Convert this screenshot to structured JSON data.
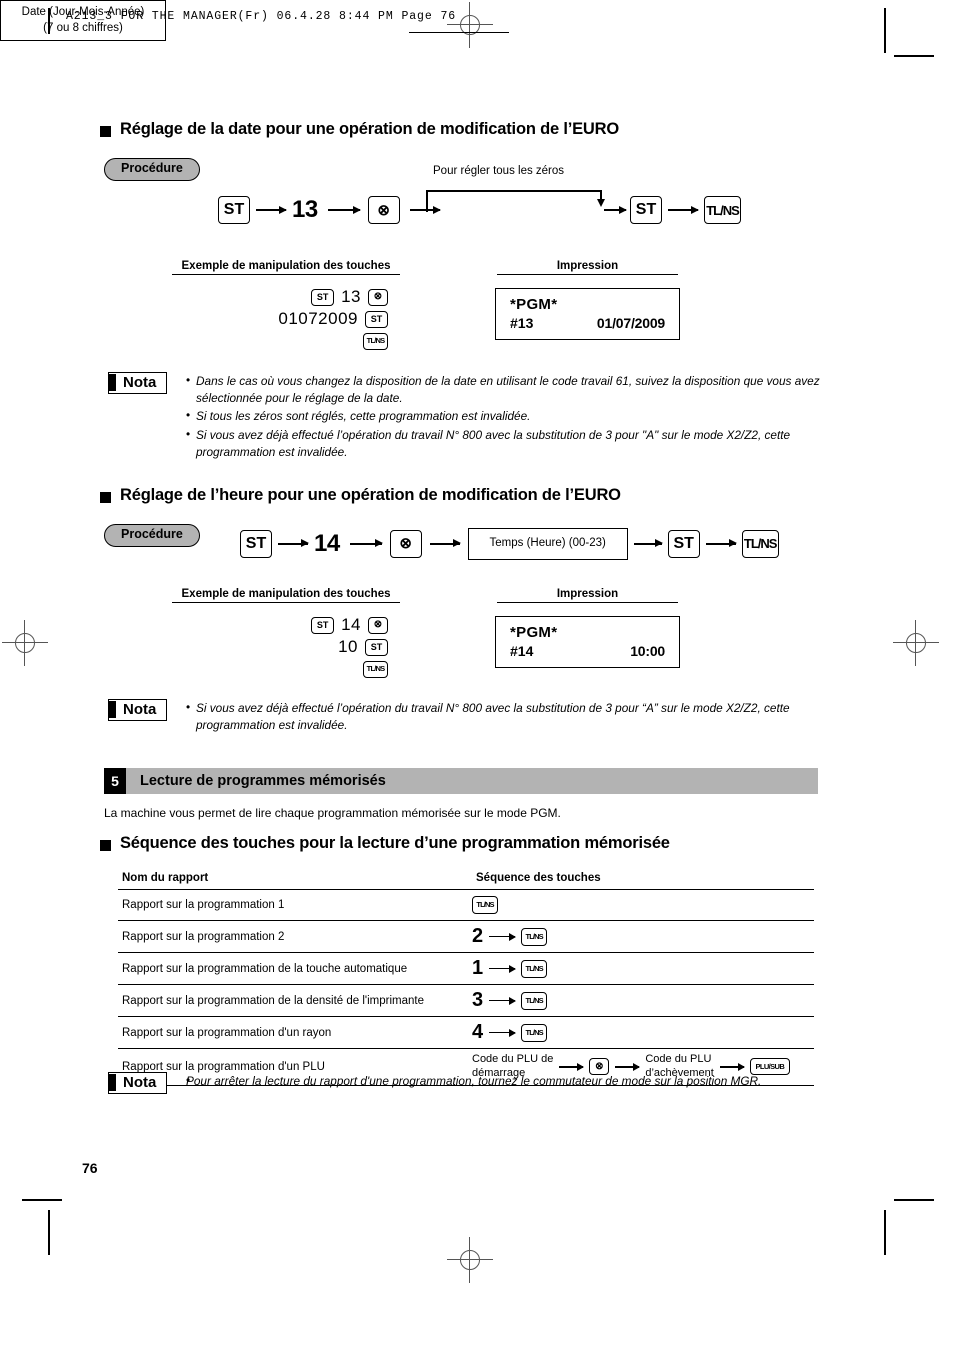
{
  "running_head": "A213_3 FOR THE MANAGER(Fr)   06.4.28 8:44 PM   Page 76",
  "page_number": "76",
  "labels": {
    "procedure": "Procédure",
    "nota": "Nota",
    "example_header": "Exemple de manipulation des touches",
    "impression_header": "Impression"
  },
  "keys": {
    "st": "ST",
    "multiply": "⊗",
    "tlns": "TL/NS",
    "plusub": "PLU/SUB"
  },
  "section_date": {
    "heading": "Réglage de la date pour une opération de modification de l’EURO",
    "flow": {
      "code": "13",
      "loop_label": "Pour régler tous les zéros",
      "databox_line1": "Date (Jour-Mois-Année)",
      "databox_line2": "(7 ou 8 chiffres)"
    },
    "example": {
      "line1_value": "13",
      "line2_value": "01072009"
    },
    "receipt": {
      "title": "*PGM*",
      "code": "#13",
      "value": "01/07/2009"
    },
    "nota": [
      "Dans le cas où vous changez la disposition de la date en utilisant le code travail 61, suivez la disposition que vous avez sélectionnée pour le réglage de la date.",
      "Si tous les zéros sont réglés, cette programmation est invalidée.",
      "Si vous avez déjà effectué l’opération du travail N° 800 avec la substitution de 3 pour \"A\" sur le mode X2/Z2, cette programmation est invalidée."
    ]
  },
  "section_time": {
    "heading": "Réglage de l’heure pour une opération de modification de l’EURO",
    "flow": {
      "code": "14",
      "databox_line1": "Temps (Heure) (00-23)"
    },
    "example": {
      "line1_value": "14",
      "line2_value": "10"
    },
    "receipt": {
      "title": "*PGM*",
      "code": "#14",
      "value": "10:00"
    },
    "nota": [
      "Si vous avez déjà effectué l’opération du travail N° 800 avec la substitution de 3 pour  “A” sur le mode X2/Z2, cette programmation est invalidée."
    ]
  },
  "section_read": {
    "number": "5",
    "banner_title": "Lecture de programmes mémorisés",
    "intro": "La machine vous permet de lire chaque programmation mémorisée sur le mode PGM.",
    "subheading": "Séquence des touches pour la lecture d’une programmation mémorisée",
    "table": {
      "headers": [
        "Nom du rapport",
        "Séquence des touches"
      ],
      "rows": [
        {
          "name": "Rapport sur la programmation 1",
          "digit": "",
          "key": "TL/NS"
        },
        {
          "name": "Rapport sur la programmation 2",
          "digit": "2",
          "key": "TL/NS"
        },
        {
          "name": "Rapport sur la programmation de la touche automatique",
          "digit": "1",
          "key": "TL/NS"
        },
        {
          "name": "Rapport sur la programmation de la densité de l'imprimante",
          "digit": "3",
          "key": "TL/NS"
        },
        {
          "name": "Rapport sur la programmation d'un rayon",
          "digit": "4",
          "key": "TL/NS"
        }
      ],
      "plu_row": {
        "name": "Rapport sur la programmation d'un PLU",
        "label1_line1": "Code du PLU de",
        "label1_line2": "démarrage",
        "label2_line1": "Code du PLU",
        "label2_line2": "d’achèvement"
      }
    },
    "nota": [
      "Pour arrêter la lecture du rapport d'une programmation, tournez le commutateur de mode sur la position MGR."
    ]
  }
}
